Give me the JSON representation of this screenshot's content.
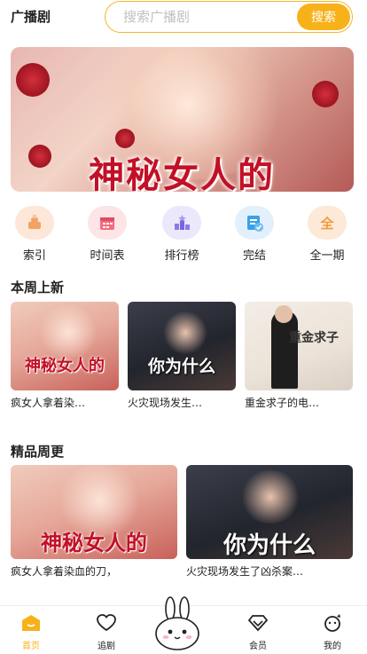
{
  "header": {
    "title": "广播剧",
    "search_placeholder": "搜索广播剧",
    "search_button": "搜索"
  },
  "banner": {
    "title": "神秘女人的"
  },
  "categories": [
    {
      "label": "索引",
      "icon": "index-icon",
      "color": "#fde7d9"
    },
    {
      "label": "时间表",
      "icon": "calendar-icon",
      "color": "#fde4e6"
    },
    {
      "label": "排行榜",
      "icon": "ranking-icon",
      "color": "#ece8fb"
    },
    {
      "label": "完结",
      "icon": "completed-icon",
      "color": "#e1f0fb"
    },
    {
      "label": "全一期",
      "icon": "full-episode-icon",
      "color": "#fde9d8"
    }
  ],
  "weekly_new": {
    "title": "本周上新",
    "items": [
      {
        "label": "疯女人拿着染…",
        "cover_title": "神秘女人的"
      },
      {
        "label": "火灾现场发生…",
        "cover_title": "你为什么"
      },
      {
        "label": "重金求子的电…",
        "cover_title": "重金求子"
      }
    ]
  },
  "featured_weekly": {
    "title": "精品周更",
    "items": [
      {
        "label": "疯女人拿着染血的刀，",
        "cover_title": "神秘女人的"
      },
      {
        "label": "火灾现场发生了凶杀案…",
        "cover_title": "你为什么"
      }
    ]
  },
  "nav": {
    "items": [
      {
        "label": "首页",
        "icon": "home-icon",
        "active": true
      },
      {
        "label": "追剧",
        "icon": "heart-icon",
        "active": false
      },
      {
        "label": "会员",
        "icon": "vip-icon",
        "active": false
      },
      {
        "label": "我的",
        "icon": "profile-icon",
        "active": false
      }
    ]
  },
  "colors": {
    "accent": "#f7b21a",
    "title_red": "#c21027"
  }
}
